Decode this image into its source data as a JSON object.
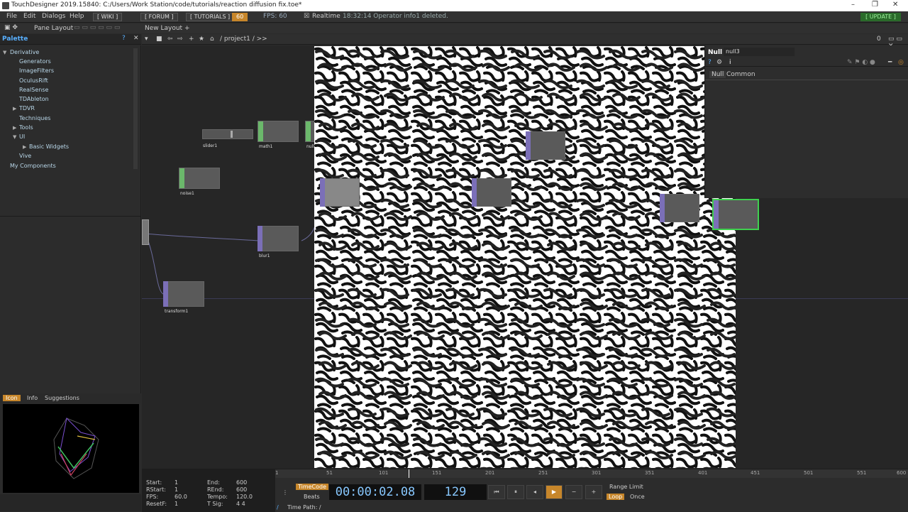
{
  "window": {
    "title": "TouchDesigner 2019.15840: C:/Users/Work Station/code/tutorials/reaction diffusion fix.toe*",
    "controls": [
      "–",
      "❐",
      "✕"
    ]
  },
  "menubar": {
    "items": [
      "File",
      "Edit",
      "Dialogs",
      "Help"
    ],
    "chips": [
      "[ WIKI ]",
      "[ FORUM ]",
      "[ TUTORIALS ]"
    ],
    "fps_cap": "60",
    "fps_label": "FPS:  60",
    "realtime": "Realtime",
    "status": "18:32:14 Operator info1 deleted.",
    "update": "[ UPDATE ]"
  },
  "toolbar2": {
    "pane_layout": "Pane Layout",
    "new_layout": "New Layout +"
  },
  "palette": {
    "title": "Palette",
    "items": [
      {
        "label": "Derivative"
      },
      {
        "label": "Generators"
      },
      {
        "label": "ImageFilters"
      },
      {
        "label": "OculusRift"
      },
      {
        "label": "RealSense"
      },
      {
        "label": "TDAbleton"
      },
      {
        "label": "TDVR"
      },
      {
        "label": "Techniques"
      },
      {
        "label": "Tools"
      },
      {
        "label": "UI"
      },
      {
        "label": "Basic Widgets"
      },
      {
        "label": "Vive"
      },
      {
        "label": "My Components"
      }
    ]
  },
  "icon_tabs": [
    "Icon",
    "Info",
    "Suggestions"
  ],
  "network": {
    "path": "/ project1 / >>",
    "nodes": [
      {
        "label": "slider1"
      },
      {
        "label": "math1"
      },
      {
        "label": "null1"
      },
      {
        "label": "noise1"
      },
      {
        "label": "blur1"
      },
      {
        "label": "transform1"
      },
      {
        "label": "null3"
      }
    ]
  },
  "param": {
    "op_type": "Null",
    "op_name": "null3",
    "tabs": [
      "Null",
      "Common"
    ]
  },
  "timeline": {
    "start_label": "Start:",
    "start": "1",
    "end_label": "End:",
    "end": "600",
    "rstart_label": "RStart:",
    "rstart": "1",
    "rend_label": "REnd:",
    "rend": "600",
    "fps_label": "FPS:",
    "fps": "60.0",
    "tempo_label": "Tempo:",
    "tempo": "120.0",
    "resetf_label": "ResetF:",
    "resetf": "1",
    "tsig_label": "T Sig:",
    "tsig": "4     4",
    "ticks": [
      "1",
      "51",
      "101",
      "151",
      "201",
      "251",
      "301",
      "351",
      "401",
      "451",
      "501",
      "551",
      "600"
    ],
    "timecode_mode": "TimeCode",
    "beats_mode": "Beats",
    "timecode": "00:00:02.08",
    "frame": "129",
    "range_limit": "Range Limit",
    "loop": "Loop",
    "once": "Once",
    "time_path": "Time Path: /"
  }
}
